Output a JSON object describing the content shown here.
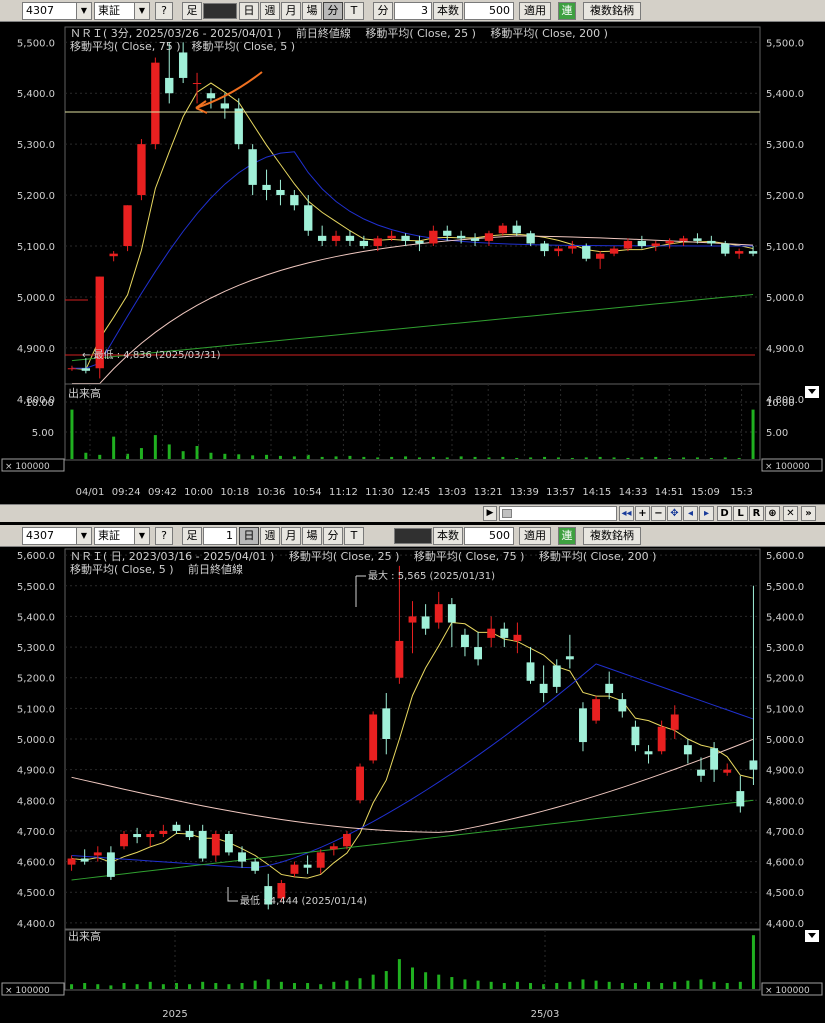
{
  "toolbar_top": {
    "code": "4307",
    "market": "東証",
    "help": "?",
    "ashi": "足",
    "periods": [
      "日",
      "週",
      "月",
      "場",
      "分",
      "T"
    ],
    "bun_label": "分",
    "bun_value": "3",
    "honsu_label": "本数",
    "honsu_value": "500",
    "apply": "適用",
    "ren": "連",
    "multi": "複数銘柄"
  },
  "toolbar_bottom": {
    "code": "4307",
    "market": "東証",
    "help": "?",
    "ashi": "足",
    "ashi_value": "1",
    "periods": [
      "日",
      "週",
      "月",
      "場",
      "分",
      "T"
    ],
    "honsu_label": "本数",
    "honsu_value": "500",
    "apply": "適用",
    "ren": "連",
    "multi": "複数銘柄"
  },
  "chart_top": {
    "title_line1": "ＮＲＩ( 3分, 2025/03/26 - 2025/04/01 )　 前日終値線　 移動平均( Close, 25 )　 移動平均( Close, 200 )",
    "title_line2": "移動平均( Close, 75 )　移動平均( Close, 5 )",
    "min_label": "← 最低 : 4,836 (2025/03/31)",
    "volume_label": "出来高",
    "volume_unit": "× 100000",
    "y_ticks": [
      "5,500.0",
      "5,400.0",
      "5,300.0",
      "5,200.0",
      "5,100.0",
      "5,000.0",
      "4,900.0",
      "4,800.0"
    ],
    "vol_ticks": [
      "10.00",
      "5.00"
    ],
    "x_ticks": [
      "04/01",
      "09:24",
      "09:42",
      "10:00",
      "10:18",
      "10:36",
      "10:54",
      "11:12",
      "11:30",
      "12:45",
      "13:03",
      "13:21",
      "13:39",
      "13:57",
      "14:15",
      "14:33",
      "14:51",
      "15:09",
      "15:3"
    ]
  },
  "chart_bottom": {
    "title_line1": "ＮＲＩ( 日, 2023/03/16 - 2025/04/01 )　 移動平均( Close, 25 )　 移動平均( Close, 75 )　 移動平均( Close, 200 )",
    "title_line2": "移動平均( Close, 5 )　 前日終値線",
    "max_label": "最大 : 5,565 (2025/01/31)",
    "min_label": "最低 : 4,444 (2025/01/14)",
    "volume_label": "出来高",
    "volume_unit": "× 100000",
    "y_ticks": [
      "5,600.0",
      "5,500.0",
      "5,400.0",
      "5,300.0",
      "5,200.0",
      "5,100.0",
      "5,000.0",
      "4,900.0",
      "4,800.0",
      "4,700.0",
      "4,600.0",
      "4,500.0",
      "4,400.0"
    ],
    "x_ticks": [
      "2025",
      "25/03"
    ]
  },
  "scroll_buttons": [
    "◂◂",
    "+",
    "−",
    "✥",
    "◂",
    "▸",
    "D",
    "L",
    "R",
    "⊕",
    "✕",
    "»"
  ],
  "chart_data": [
    {
      "type": "candlestick",
      "title": "ＮＲＩ( 3分, 2025/03/26 - 2025/04/01 )",
      "ylim": [
        4780,
        5530
      ],
      "y_unit": "JPY",
      "series": [
        {
          "name": "移動平均( Close, 5 )",
          "color": "#e8d860"
        },
        {
          "name": "移動平均( Close, 25 )",
          "color": "#2030d0"
        },
        {
          "name": "移動平均( Close, 75 )",
          "color": "#f0c8c0"
        },
        {
          "name": "移動平均( Close, 200 )",
          "color": "#30a030"
        }
      ],
      "candles": [
        [
          4860,
          4865,
          4855,
          4860
        ],
        [
          4860,
          4880,
          4850,
          4855
        ],
        [
          4860,
          5040,
          4840,
          5040
        ],
        [
          5080,
          5090,
          5070,
          5085
        ],
        [
          5100,
          5180,
          5090,
          5180
        ],
        [
          5200,
          5310,
          5190,
          5300
        ],
        [
          5300,
          5470,
          5290,
          5460
        ],
        [
          5430,
          5500,
          5380,
          5400
        ],
        [
          5480,
          5500,
          5420,
          5430
        ],
        [
          5420,
          5440,
          5380,
          5420
        ],
        [
          5400,
          5410,
          5370,
          5390
        ],
        [
          5380,
          5400,
          5350,
          5370
        ],
        [
          5370,
          5390,
          5290,
          5300
        ],
        [
          5290,
          5300,
          5200,
          5220
        ],
        [
          5220,
          5250,
          5190,
          5210
        ],
        [
          5210,
          5230,
          5180,
          5200
        ],
        [
          5200,
          5210,
          5170,
          5180
        ],
        [
          5180,
          5200,
          5120,
          5130
        ],
        [
          5120,
          5140,
          5100,
          5110
        ],
        [
          5110,
          5130,
          5100,
          5120
        ],
        [
          5120,
          5130,
          5100,
          5110
        ],
        [
          5110,
          5120,
          5095,
          5100
        ],
        [
          5100,
          5120,
          5090,
          5115
        ],
        [
          5115,
          5130,
          5110,
          5120
        ],
        [
          5120,
          5125,
          5100,
          5110
        ],
        [
          5110,
          5120,
          5090,
          5105
        ],
        [
          5105,
          5140,
          5100,
          5130
        ],
        [
          5130,
          5140,
          5110,
          5120
        ],
        [
          5120,
          5130,
          5105,
          5115
        ],
        [
          5115,
          5125,
          5100,
          5110
        ],
        [
          5110,
          5130,
          5100,
          5125
        ],
        [
          5125,
          5145,
          5120,
          5140
        ],
        [
          5140,
          5150,
          5120,
          5125
        ],
        [
          5125,
          5130,
          5100,
          5105
        ],
        [
          5105,
          5110,
          5080,
          5090
        ],
        [
          5090,
          5100,
          5080,
          5095
        ],
        [
          5095,
          5110,
          5085,
          5100
        ],
        [
          5100,
          5105,
          5070,
          5075
        ],
        [
          5075,
          5090,
          5055,
          5085
        ],
        [
          5085,
          5100,
          5080,
          5095
        ],
        [
          5095,
          5115,
          5090,
          5110
        ],
        [
          5110,
          5120,
          5095,
          5100
        ],
        [
          5100,
          5110,
          5090,
          5105
        ],
        [
          5105,
          5115,
          5095,
          5110
        ],
        [
          5110,
          5120,
          5100,
          5115
        ],
        [
          5115,
          5125,
          5105,
          5110
        ],
        [
          5110,
          5120,
          5100,
          5105
        ],
        [
          5105,
          5110,
          5080,
          5085
        ],
        [
          5085,
          5095,
          5075,
          5090
        ],
        [
          5090,
          5100,
          5080,
          5085
        ]
      ],
      "volume": [
        9.5,
        1.2,
        0.8,
        4.3,
        1.0,
        2.1,
        4.6,
        2.8,
        1.5,
        2.5,
        1.2,
        1.0,
        0.9,
        0.7,
        0.8,
        0.6,
        0.5,
        0.8,
        0.4,
        0.5,
        0.6,
        0.4,
        0.3,
        0.4,
        0.5,
        0.3,
        0.4,
        0.3,
        0.5,
        0.4,
        0.3,
        0.4,
        0.2,
        0.3,
        0.4,
        0.3,
        0.2,
        0.3,
        0.4,
        0.3,
        0.2,
        0.3,
        0.4,
        0.2,
        0.3,
        0.3,
        0.2,
        0.3,
        0.2,
        9.5
      ],
      "annotations": [
        "← 最低 : 4,836 (2025/03/31)"
      ]
    },
    {
      "type": "candlestick",
      "title": "ＮＲＩ( 日, 2023/03/16 - 2025/04/01 )",
      "ylim": [
        4380,
        5620
      ],
      "y_unit": "JPY",
      "series": [
        {
          "name": "移動平均( Close, 5 )",
          "color": "#e8d860"
        },
        {
          "name": "移動平均( Close, 25 )",
          "color": "#2030d0"
        },
        {
          "name": "移動平均( Close, 75 )",
          "color": "#f0c8c0"
        },
        {
          "name": "移動平均( Close, 200 )",
          "color": "#30a030"
        }
      ],
      "candles": [
        [
          4590,
          4620,
          4570,
          4610
        ],
        [
          4610,
          4640,
          4590,
          4600
        ],
        [
          4620,
          4650,
          4600,
          4630
        ],
        [
          4630,
          4650,
          4540,
          4550
        ],
        [
          4650,
          4700,
          4640,
          4690
        ],
        [
          4690,
          4710,
          4660,
          4680
        ],
        [
          4680,
          4700,
          4650,
          4690
        ],
        [
          4690,
          4720,
          4680,
          4700
        ],
        [
          4720,
          4730,
          4690,
          4700
        ],
        [
          4700,
          4720,
          4670,
          4680
        ],
        [
          4700,
          4720,
          4600,
          4610
        ],
        [
          4620,
          4700,
          4600,
          4690
        ],
        [
          4690,
          4700,
          4620,
          4630
        ],
        [
          4630,
          4650,
          4580,
          4600
        ],
        [
          4600,
          4610,
          4560,
          4570
        ],
        [
          4520,
          4560,
          4444,
          4460
        ],
        [
          4480,
          4540,
          4470,
          4530
        ],
        [
          4560,
          4600,
          4550,
          4590
        ],
        [
          4590,
          4620,
          4560,
          4580
        ],
        [
          4580,
          4640,
          4560,
          4630
        ],
        [
          4640,
          4660,
          4620,
          4650
        ],
        [
          4650,
          4700,
          4640,
          4690
        ],
        [
          4800,
          4920,
          4790,
          4910
        ],
        [
          4930,
          5090,
          4920,
          5080
        ],
        [
          5100,
          5150,
          4950,
          5000
        ],
        [
          5200,
          5565,
          5180,
          5320
        ],
        [
          5380,
          5450,
          5280,
          5400
        ],
        [
          5400,
          5440,
          5340,
          5360
        ],
        [
          5380,
          5480,
          5360,
          5440
        ],
        [
          5440,
          5460,
          5300,
          5380
        ],
        [
          5340,
          5360,
          5270,
          5300
        ],
        [
          5300,
          5350,
          5240,
          5260
        ],
        [
          5330,
          5400,
          5300,
          5360
        ],
        [
          5360,
          5380,
          5300,
          5330
        ],
        [
          5320,
          5380,
          5280,
          5340
        ],
        [
          5250,
          5300,
          5180,
          5190
        ],
        [
          5180,
          5240,
          5120,
          5150
        ],
        [
          5240,
          5260,
          5150,
          5170
        ],
        [
          5270,
          5340,
          5230,
          5260
        ],
        [
          5100,
          5120,
          4960,
          4990
        ],
        [
          5060,
          5140,
          5050,
          5130
        ],
        [
          5180,
          5220,
          5130,
          5150
        ],
        [
          5130,
          5150,
          5070,
          5090
        ],
        [
          5040,
          5060,
          4960,
          4980
        ],
        [
          4960,
          4980,
          4920,
          4950
        ],
        [
          4960,
          5060,
          4950,
          5040
        ],
        [
          5030,
          5110,
          5000,
          5080
        ],
        [
          4980,
          5000,
          4920,
          4950
        ],
        [
          4900,
          4940,
          4860,
          4880
        ],
        [
          4970,
          4990,
          4860,
          4900
        ],
        [
          4890,
          4920,
          4880,
          4900
        ],
        [
          4830,
          4880,
          4760,
          4780
        ],
        [
          4930,
          5500,
          4850,
          4900
        ]
      ],
      "volume": [
        0.4,
        0.5,
        0.4,
        0.3,
        0.5,
        0.4,
        0.6,
        0.4,
        0.5,
        0.4,
        0.6,
        0.5,
        0.4,
        0.5,
        0.7,
        0.8,
        0.6,
        0.5,
        0.5,
        0.4,
        0.6,
        0.7,
        0.9,
        1.2,
        1.5,
        2.5,
        1.8,
        1.4,
        1.2,
        1.0,
        0.8,
        0.7,
        0.6,
        0.5,
        0.6,
        0.5,
        0.4,
        0.5,
        0.6,
        0.8,
        0.7,
        0.6,
        0.5,
        0.5,
        0.6,
        0.5,
        0.6,
        0.7,
        0.8,
        0.6,
        0.5,
        0.6,
        4.5
      ],
      "annotations": [
        "最大 : 5,565 (2025/01/31)",
        "最低 : 4,444 (2025/01/14)"
      ]
    }
  ]
}
